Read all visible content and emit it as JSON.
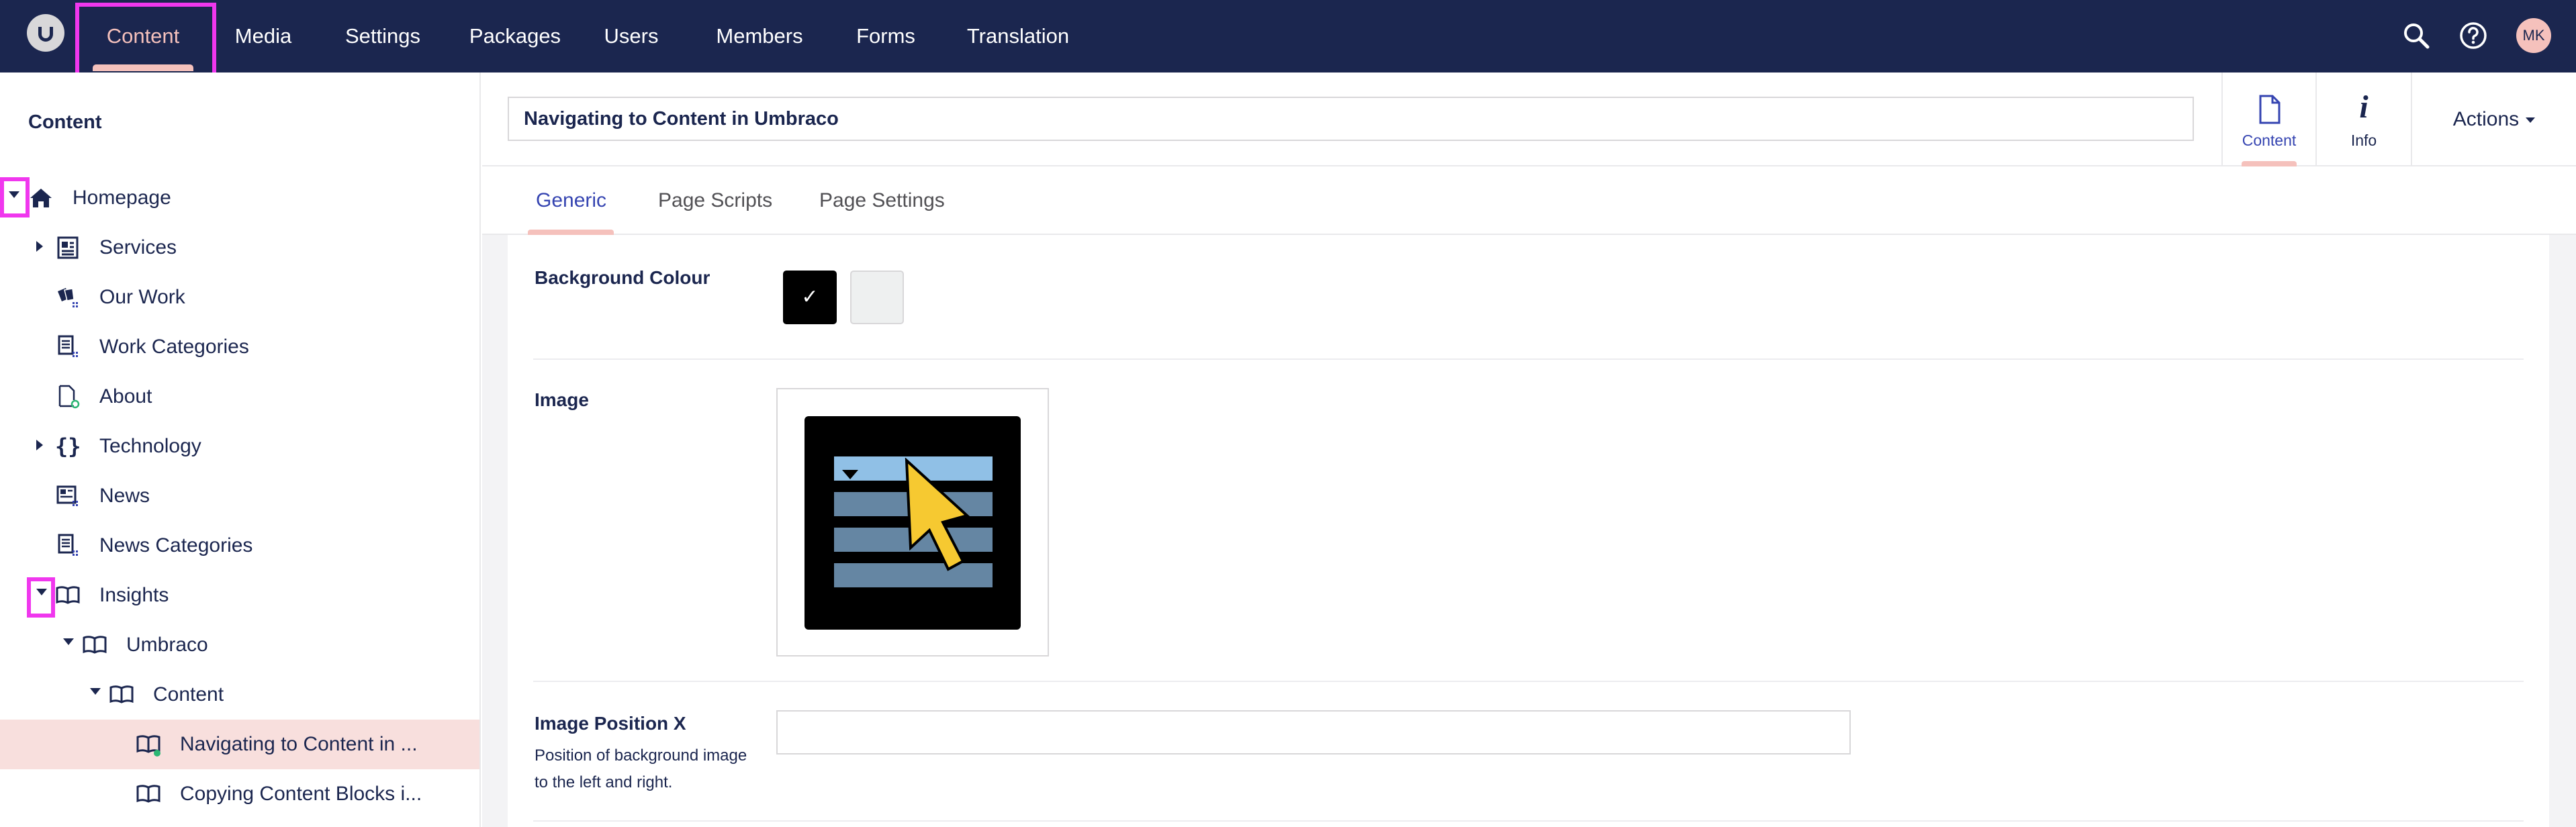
{
  "topbar": {
    "nav": [
      {
        "label": "Content",
        "active": true
      },
      {
        "label": "Media"
      },
      {
        "label": "Settings"
      },
      {
        "label": "Packages"
      },
      {
        "label": "Users"
      },
      {
        "label": "Members"
      },
      {
        "label": "Forms"
      },
      {
        "label": "Translation"
      }
    ],
    "icons": [
      "search-icon",
      "help-icon"
    ],
    "avatar_initials": "MK"
  },
  "sidebar": {
    "title": "Content",
    "tree": [
      {
        "label": "Homepage",
        "icon": "home-icon",
        "caret": "down"
      },
      {
        "label": "Services",
        "icon": "newspaper-icon",
        "caret": "right"
      },
      {
        "label": "Our Work",
        "icon": "cards-icon"
      },
      {
        "label": "Work Categories",
        "icon": "document-list-icon"
      },
      {
        "label": "About",
        "icon": "document-icon"
      },
      {
        "label": "Technology",
        "icon": "braces-icon",
        "caret": "right"
      },
      {
        "label": "News",
        "icon": "news-icon"
      },
      {
        "label": "News Categories",
        "icon": "document-list-icon"
      },
      {
        "label": "Insights",
        "icon": "book-icon",
        "caret": "down"
      },
      {
        "label": "Umbraco",
        "icon": "book-icon",
        "caret": "down"
      },
      {
        "label": "Content",
        "icon": "book-icon",
        "caret": "down"
      },
      {
        "label": "Navigating to Content in ...",
        "icon": "book-icon",
        "active": true
      },
      {
        "label": "Copying Content Blocks i...",
        "icon": "book-icon"
      }
    ]
  },
  "editor": {
    "name_value": "Navigating to Content in Umbraco",
    "apps": [
      {
        "label": "Content",
        "icon": "document-icon",
        "active": true
      },
      {
        "label": "Info",
        "icon": "info-icon"
      }
    ],
    "actions_label": "Actions",
    "tabs": [
      {
        "label": "Generic",
        "active": true
      },
      {
        "label": "Page Scripts"
      },
      {
        "label": "Page Settings"
      }
    ]
  },
  "properties": {
    "background_colour": {
      "label": "Background Colour",
      "swatches": [
        "#000000",
        "#eef0f0"
      ],
      "selected": "#000000",
      "check": "✓"
    },
    "image": {
      "label": "Image"
    },
    "image_position_x": {
      "label": "Image Position X",
      "description": "Position of background image to the left and right.",
      "value": ""
    }
  },
  "colors": {
    "topbar_bg": "#1b264f",
    "accent_pink": "#f5c1bc",
    "active_tab": "#3544b1",
    "highlight_magenta": "#f037ee",
    "selected_row": "#f8dfdd",
    "thumb_bar_light": "#90c0e6",
    "thumb_bar": "#6586a3",
    "thumb_cursor": "#f6c931"
  }
}
